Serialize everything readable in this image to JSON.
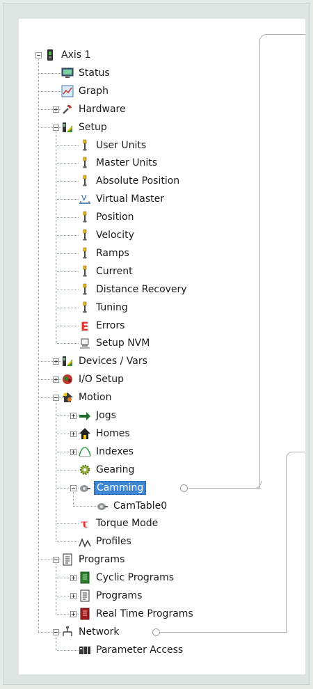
{
  "tree": {
    "nodes": [
      {
        "key": "axis1",
        "label": "Axis 1",
        "level": 0,
        "icon": "axis-icon",
        "expander": "minus"
      },
      {
        "key": "status",
        "label": "Status",
        "level": 1,
        "icon": "monitor-icon"
      },
      {
        "key": "graph",
        "label": "Graph",
        "level": 1,
        "icon": "graph-icon"
      },
      {
        "key": "hardware",
        "label": "Hardware",
        "level": 1,
        "icon": "hardware-icon",
        "expander": "plus"
      },
      {
        "key": "setup",
        "label": "Setup",
        "level": 1,
        "icon": "setup-icon",
        "expander": "minus"
      },
      {
        "key": "user-units",
        "label": "User Units",
        "level": 2,
        "icon": "parameter-icon"
      },
      {
        "key": "master-units",
        "label": "Master Units",
        "level": 2,
        "icon": "parameter-icon"
      },
      {
        "key": "absolute-position",
        "label": "Absolute Position",
        "level": 2,
        "icon": "parameter-icon"
      },
      {
        "key": "virtual-master",
        "label": "Virtual Master",
        "level": 2,
        "icon": "virtual-master-icon"
      },
      {
        "key": "position",
        "label": "Position",
        "level": 2,
        "icon": "parameter-icon"
      },
      {
        "key": "velocity",
        "label": "Velocity",
        "level": 2,
        "icon": "parameter-icon"
      },
      {
        "key": "ramps",
        "label": "Ramps",
        "level": 2,
        "icon": "parameter-icon"
      },
      {
        "key": "current",
        "label": "Current",
        "level": 2,
        "icon": "parameter-icon"
      },
      {
        "key": "distance-recovery",
        "label": "Distance Recovery",
        "level": 2,
        "icon": "parameter-icon"
      },
      {
        "key": "tuning",
        "label": "Tuning",
        "level": 2,
        "icon": "parameter-icon"
      },
      {
        "key": "errors",
        "label": "Errors",
        "level": 2,
        "icon": "errors-icon"
      },
      {
        "key": "setup-nvm",
        "label": "Setup NVM",
        "level": 2,
        "icon": "nvm-icon"
      },
      {
        "key": "devices-vars",
        "label": "Devices / Vars",
        "level": 1,
        "icon": "setup-icon",
        "expander": "plus"
      },
      {
        "key": "io-setup",
        "label": "I/O Setup",
        "level": 1,
        "icon": "io-icon",
        "expander": "plus"
      },
      {
        "key": "motion",
        "label": "Motion",
        "level": 1,
        "icon": "motion-icon",
        "expander": "minus"
      },
      {
        "key": "jogs",
        "label": "Jogs",
        "level": 2,
        "icon": "jog-icon",
        "expander": "plus"
      },
      {
        "key": "homes",
        "label": "Homes",
        "level": 2,
        "icon": "home-icon",
        "expander": "plus"
      },
      {
        "key": "indexes",
        "label": "Indexes",
        "level": 2,
        "icon": "index-icon",
        "expander": "plus"
      },
      {
        "key": "gearing",
        "label": "Gearing",
        "level": 2,
        "icon": "gear-icon"
      },
      {
        "key": "camming",
        "label": "Camming",
        "level": 2,
        "icon": "cam-icon",
        "expander": "minus",
        "selected": true
      },
      {
        "key": "camtable0",
        "label": "CamTable0",
        "level": 3,
        "icon": "cam-icon"
      },
      {
        "key": "torque-mode",
        "label": "Torque Mode",
        "level": 2,
        "icon": "torque-icon"
      },
      {
        "key": "profiles",
        "label": "Profiles",
        "level": 2,
        "icon": "profile-icon"
      },
      {
        "key": "programs-root",
        "label": "Programs",
        "level": 1,
        "icon": "program-icon",
        "expander": "minus"
      },
      {
        "key": "cyclic-programs",
        "label": "Cyclic Programs",
        "level": 2,
        "icon": "cyclic-program-icon",
        "expander": "plus"
      },
      {
        "key": "programs",
        "label": "Programs",
        "level": 2,
        "icon": "program-icon",
        "expander": "plus"
      },
      {
        "key": "real-time-programs",
        "label": "Real Time Programs",
        "level": 2,
        "icon": "realtime-program-icon",
        "expander": "plus"
      },
      {
        "key": "network",
        "label": "Network",
        "level": 1,
        "icon": "network-icon",
        "expander": "minus"
      },
      {
        "key": "parameter-access",
        "label": "Parameter Access",
        "level": 2,
        "icon": "parameter-access-icon"
      }
    ]
  },
  "colors": {
    "selection": "#3d86d6",
    "callout": "#a8b1ad",
    "errors": "#e5322d",
    "torque": "#e5322d",
    "green": "#2f7d2f"
  }
}
